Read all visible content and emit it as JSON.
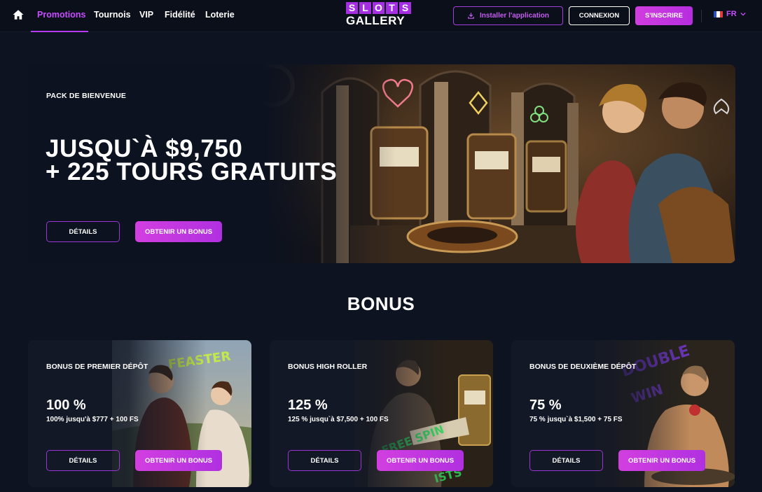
{
  "header": {
    "home_icon": "home-icon",
    "nav": [
      {
        "label": "Promotions",
        "active": true
      },
      {
        "label": "Tournois"
      },
      {
        "label": "VIP"
      },
      {
        "label": "Fidélité"
      },
      {
        "label": "Loterie"
      }
    ],
    "logo": {
      "top": "SLOTS",
      "bottom": "GALLERY"
    },
    "install_label": "Installer l'application",
    "install_icon": "download-icon",
    "login_label": "CONNEXION",
    "signup_label": "S'INSCRIRE",
    "language": "FR",
    "accent_color": "#c64dff"
  },
  "hero": {
    "subtitle": "PACK DE BIENVENUE",
    "title_line1": "JUSQU`À $9,750",
    "title_line2": "+ 225 TOURS GRATUITS",
    "details_label": "DÉTAILS",
    "bonus_label": "OBTENIR UN BONUS"
  },
  "bonus_section": {
    "title": "BONUS",
    "cards": [
      {
        "title": "BONUS DE PREMIER DÉPÔT",
        "percent": "100 %",
        "description": "100% jusqu'à $777 + 100 FS",
        "details_label": "DÉTAILS",
        "bonus_label": "OBTENIR UN BONUS"
      },
      {
        "title": "BONUS HIGH ROLLER",
        "percent": "125 %",
        "description": "125 % jusqu`à $7,500 + 100 FS",
        "details_label": "DÉTAILS",
        "bonus_label": "OBTENIR UN BONUS"
      },
      {
        "title": "BONUS DE DEUXIÈME DÉPÔT",
        "percent": "75 %",
        "description": "75 % jusqu`à $1,500 + 75 FS",
        "details_label": "DÉTAILS",
        "bonus_label": "OBTENIR UN BONUS"
      }
    ]
  }
}
